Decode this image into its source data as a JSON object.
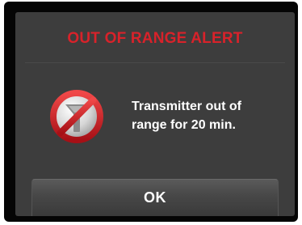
{
  "alert": {
    "title": "OUT OF RANGE ALERT",
    "message": "Transmitter out of\nrange for 20 min.",
    "icon": "transmitter-out-of-range-icon",
    "ok_label": "OK"
  },
  "colors": {
    "title": "#d8222a",
    "screen_background": "#3d3d3d",
    "frame": "#050505",
    "text": "#ffffff"
  }
}
